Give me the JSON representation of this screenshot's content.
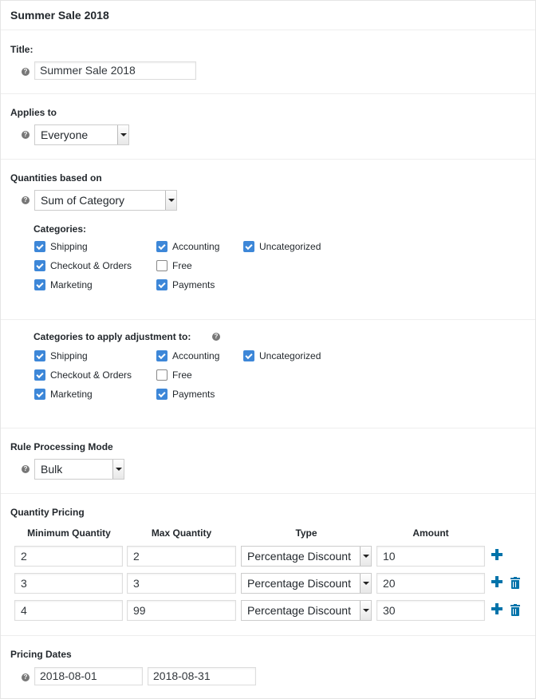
{
  "header": {
    "title": "Summer Sale 2018"
  },
  "title_section": {
    "label": "Title:",
    "value": "Summer Sale 2018"
  },
  "applies_to": {
    "label": "Applies to",
    "selected": "Everyone"
  },
  "quantities": {
    "label": "Quantities based on",
    "selected": "Sum of Category",
    "categories_label": "Categories:",
    "categories": [
      {
        "label": "Shipping",
        "checked": true
      },
      {
        "label": "Accounting",
        "checked": true
      },
      {
        "label": "Uncategorized",
        "checked": true
      },
      {
        "label": "Checkout & Orders",
        "checked": true
      },
      {
        "label": "Free",
        "checked": false
      },
      {
        "label": "Marketing",
        "checked": true
      },
      {
        "label": "Payments",
        "checked": true
      }
    ]
  },
  "adjust": {
    "label": "Categories to apply adjustment to:",
    "categories": [
      {
        "label": "Shipping",
        "checked": true
      },
      {
        "label": "Accounting",
        "checked": true
      },
      {
        "label": "Uncategorized",
        "checked": true
      },
      {
        "label": "Checkout & Orders",
        "checked": true
      },
      {
        "label": "Free",
        "checked": false
      },
      {
        "label": "Marketing",
        "checked": true
      },
      {
        "label": "Payments",
        "checked": true
      }
    ]
  },
  "rule_mode": {
    "label": "Rule Processing Mode",
    "selected": "Bulk"
  },
  "pricing": {
    "label": "Quantity Pricing",
    "columns": [
      "Minimum Quantity",
      "Max Quantity",
      "Type",
      "Amount"
    ],
    "rows": [
      {
        "min": "2",
        "max": "2",
        "type": "Percentage Discount",
        "amount": "10"
      },
      {
        "min": "3",
        "max": "3",
        "type": "Percentage Discount",
        "amount": "20"
      },
      {
        "min": "4",
        "max": "99",
        "type": "Percentage Discount",
        "amount": "30"
      }
    ]
  },
  "dates": {
    "label": "Pricing Dates",
    "from": "2018-08-01",
    "to": "2018-08-31"
  },
  "icons": {
    "help": "help-icon",
    "add": "plus-icon",
    "delete": "trash-icon"
  },
  "colors": {
    "accent": "#0073aa",
    "checkbox": "#3d87d8"
  }
}
